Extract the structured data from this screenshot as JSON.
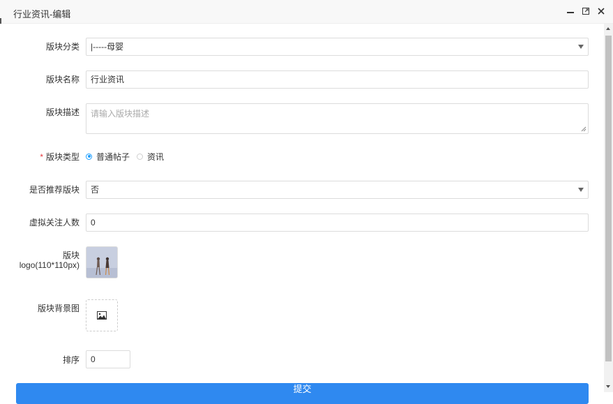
{
  "window": {
    "title": "行业资讯-编辑",
    "controls": {
      "minimize_icon": "minimize-icon",
      "maximize_icon": "maximize-icon",
      "close_icon": "close-icon"
    }
  },
  "form": {
    "category": {
      "label": "版块分类",
      "value": "|-----母婴"
    },
    "name": {
      "label": "版块名称",
      "value": "行业资讯"
    },
    "description": {
      "label": "版块描述",
      "value": "",
      "placeholder": "请输入版块描述"
    },
    "type": {
      "required_mark": "*",
      "label": "版块类型",
      "options": [
        {
          "label": "普通帖子",
          "selected": true
        },
        {
          "label": "资讯",
          "selected": false
        }
      ]
    },
    "recommended": {
      "label": "是否推荐版块",
      "value": "否"
    },
    "virtual_followers": {
      "label": "虚拟关注人数",
      "value": "0"
    },
    "logo": {
      "label": "版块logo(110*110px)"
    },
    "background": {
      "label": "版块背景图",
      "icon": "image-icon"
    },
    "sort": {
      "label": "排序",
      "value": "0"
    },
    "submit_label": "提交"
  },
  "colors": {
    "accent": "#2f89f0",
    "required": "#e6393d",
    "radio": "#1e9fff"
  }
}
